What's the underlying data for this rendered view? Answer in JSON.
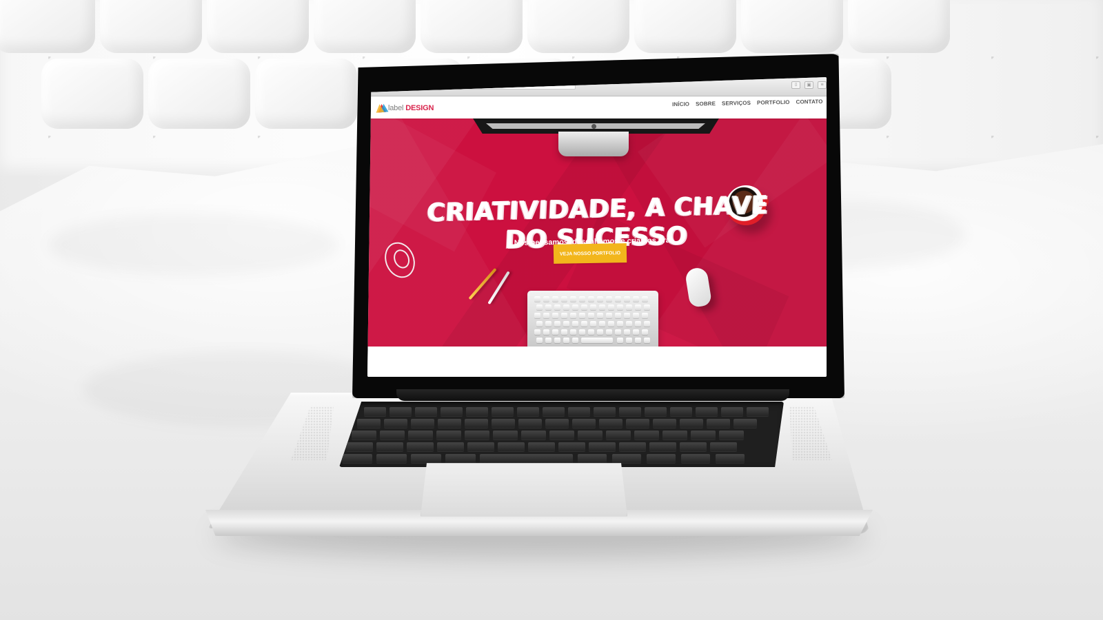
{
  "browser": {
    "controls": [
      "‹",
      "›"
    ],
    "toolbar_icons": [
      "⇩",
      "▣",
      "≡"
    ]
  },
  "site": {
    "logo": {
      "prefix": "label",
      "emphasis": "DESIGN"
    },
    "nav_items": [
      "INÍCIO",
      "SOBRE",
      "SERVIÇOS",
      "PORTFOLIO",
      "CONTATO"
    ]
  },
  "hero": {
    "title": "CRIATIVIDADE, A CHAVE DO SUCESSO",
    "subtitle": "Nós pensamos, desenhamos e criamos pra você!",
    "cta": "VEJA NOSSO PORTFOLIO"
  },
  "colors": {
    "hero_red": "#cc103f",
    "cta_yellow": "#f2b61c",
    "brand_red": "#d8234b",
    "logo_blue": "#1c9bd7",
    "logo_yellow": "#f6b326"
  },
  "icons": {
    "logo_mark": "tri-color-triangle-logo-icon",
    "apple": "apple-icon",
    "coffee": "coffee-cup-icon",
    "mouse": "mouse-icon",
    "keyboard": "keyboard-icon",
    "earphones": "earphones-icon",
    "pencils": "pencil-icon"
  }
}
